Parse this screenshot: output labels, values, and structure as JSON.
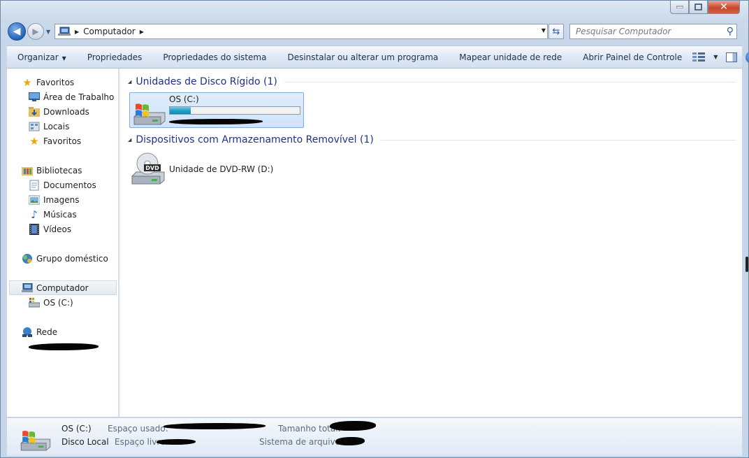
{
  "window": {
    "caption_min": "—",
    "caption_max": "□",
    "caption_close": "✕"
  },
  "address_bar": {
    "location": "Computador",
    "search_placeholder": "Pesquisar Computador"
  },
  "toolbar": {
    "items": [
      {
        "label": "Organizar",
        "dropdown": true
      },
      {
        "label": "Propriedades"
      },
      {
        "label": "Propriedades do sistema"
      },
      {
        "label": "Desinstalar ou alterar um programa"
      },
      {
        "label": "Mapear unidade de rede"
      },
      {
        "label": "Abrir Painel de Controle"
      }
    ]
  },
  "nav": {
    "favorites": {
      "label": "Favoritos",
      "items": [
        "Área de Trabalho",
        "Downloads",
        "Locais",
        "Favoritos"
      ]
    },
    "libraries": {
      "label": "Bibliotecas",
      "items": [
        "Documentos",
        "Imagens",
        "Músicas",
        "Vídeos"
      ]
    },
    "homegroup": "Grupo doméstico",
    "computer": {
      "label": "Computador",
      "items": [
        "OS (C:)"
      ]
    },
    "network": {
      "label": "Rede"
    }
  },
  "content": {
    "hard_disks": {
      "title": "Unidades de Disco Rígido (1)",
      "drive": {
        "name": "OS (C:)",
        "used_fraction": 0.16
      }
    },
    "removable": {
      "title": "Dispositivos com Armazenamento Removível (1)",
      "drive": {
        "name": "Unidade de DVD-RW (D:)",
        "icon_text": "DVD"
      }
    }
  },
  "details": {
    "name": "OS (C:)",
    "type": "Disco Local",
    "used_label": "Espaço usado:",
    "free_label": "Espaço livre:",
    "total_label": "Tamanho total:",
    "fs_label": "Sistema de arquivos:"
  }
}
